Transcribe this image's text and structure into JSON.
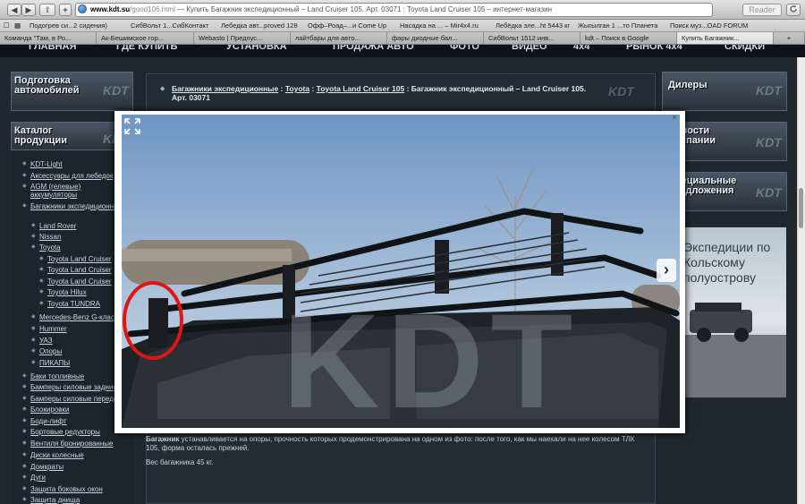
{
  "browser": {
    "back_label": "◀",
    "forward_label": "▶",
    "share_label": "⇪",
    "newtab_label": "+",
    "url_domain": "www.kdt.su",
    "url_path": "/good106.html",
    "url_title": " — Купить Багажник экспедиционный – Land Cruiser 105. Арт. 03071 : Toyota Land Cruiser 105 – интернет-магазин",
    "reader_label": "Reader",
    "bookmarks": [
      "Подогрев си...2 сидения)",
      "СибВольт 1...СибКонтакт",
      "Лебедка авт...proved 128",
      "Офф–Роад–...и Come Up",
      "Насадка на ... – Mir4x4.ru",
      "Лебёдка эле...ht 5443 кг",
      "Жыгылган 1 ...то Планета",
      "Поиск муз...OAD FORUM"
    ],
    "tabs": [
      "Команда \"Там, в Ро...",
      "Ак-Бешимское гор...",
      "Webasto | Предпус...",
      "лайтбары для авто...",
      "фары диодные бал...",
      "СибВольт 1512 инв...",
      "kdt – Поиск в Google",
      "Купить Багажник..."
    ],
    "add_tab_label": "+"
  },
  "site_nav": [
    "ГЛАВНАЯ",
    "ГДЕ КУПИТЬ",
    "УСТАНОВКА",
    "ПРОДАЖА АВТО",
    "ФОТО",
    "ВИДЕО",
    "4x4",
    "РЫНОК 4x4",
    "СКИДКИ"
  ],
  "left": {
    "panel1_title": "Подготовка автомобилей",
    "panel2_title": "Каталог продукции",
    "logo": "KDT",
    "catalog": [
      "KDT-Light",
      "Аксессуары для лебедок",
      "AGM (гелевые) аккумуляторы",
      "Багажники экспедиционные",
      "Land Rover",
      "Nissan",
      "Toyota",
      "Toyota Land Cruiser",
      "Toyota Land Cruiser",
      "Toyota Land Cruiser",
      "Toyota Hilux",
      "Toyota TUNDRA",
      "Mercedes-Benz G-класс",
      "Hummer",
      "УАЗ",
      "Опоры",
      "ПИКАПЫ",
      "Баки топливные",
      "Бамперы силовые задние",
      "Бамперы силовые передние",
      "Блокировки",
      "Боди-лифт",
      "Бортовые редукторы",
      "Вентиля бронированные",
      "Диски колесные",
      "Домкраты",
      "Дуги",
      "Защита боковых окон",
      "Защита днища"
    ]
  },
  "right": {
    "panel1_title": "Дилеры",
    "panel2_title": "Новости компании",
    "panel3_title": "Специальные предложения",
    "logo": "KDT",
    "ad_text": "Экспедиции по Кольскому полуострову"
  },
  "breadcrumb": {
    "c1": "Багажники экспедиционные",
    "sep": " : ",
    "c2": "Toyota",
    "c3": "Toyota Land Cruiser 105",
    "tail": " : Багажник экспедиционный – Land Cruiser 105. Арт. 03071"
  },
  "description": {
    "bold": "Багажник",
    "text": " устанавливается на опоры, прочность которых продемонстрирована на одном из фото: после того, как мы наехали на нее колесом ТЛК 105, форма осталась прежней.",
    "weight": "Вес багажника 45 кг."
  },
  "lightbox": {
    "close_label": "×",
    "next_label": "›",
    "watermark": "KDT"
  }
}
